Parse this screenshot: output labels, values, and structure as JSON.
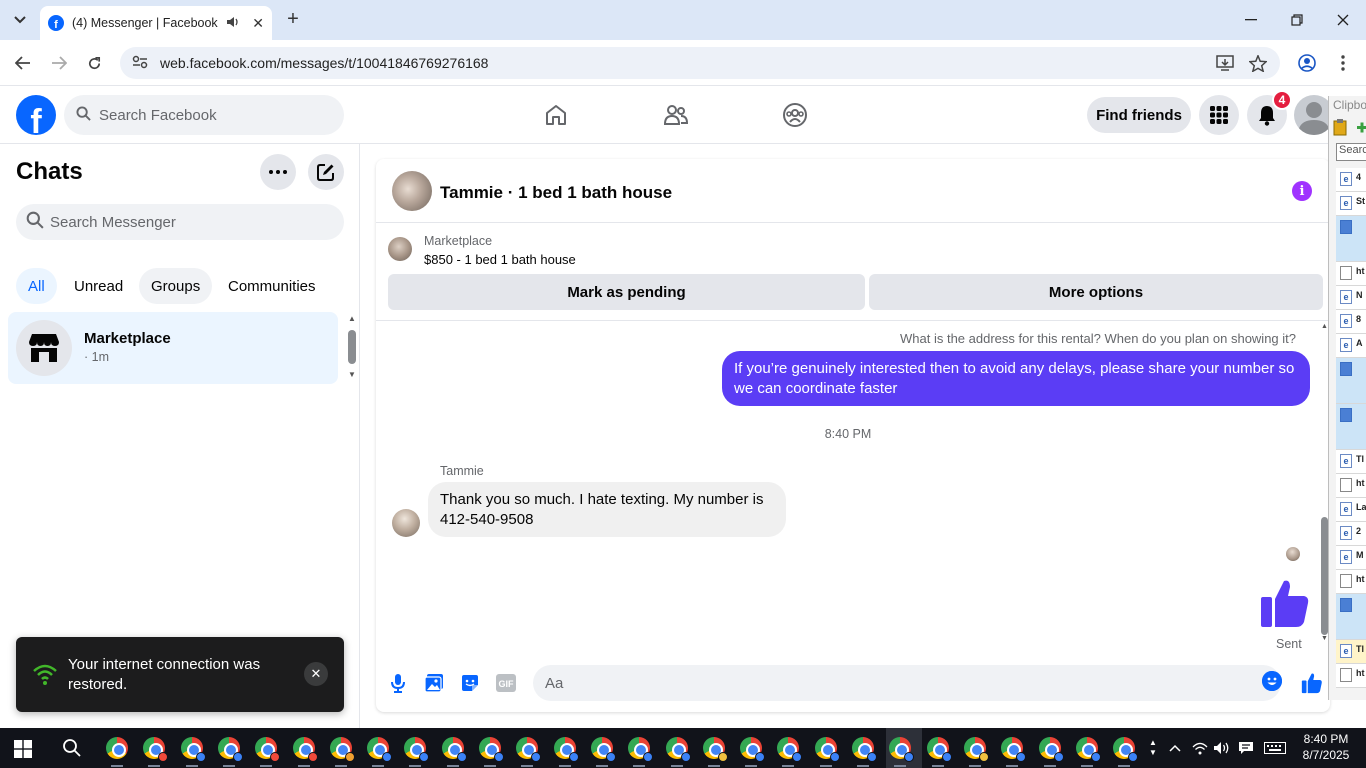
{
  "browser": {
    "tab_title": "(4) Messenger | Facebook",
    "url": "web.facebook.com/messages/t/10041846769276168",
    "tab_close": "✕",
    "new_tab": "+"
  },
  "header": {
    "search_placeholder": "Search Facebook",
    "find_friends": "Find friends",
    "notification_count": "4",
    "logo_letter": "f"
  },
  "sidebar": {
    "title": "Chats",
    "search_placeholder": "Search Messenger",
    "filters": [
      "All",
      "Unread",
      "Groups",
      "Communities"
    ],
    "chat": {
      "name": "Marketplace",
      "time": "· 1m"
    }
  },
  "toast": {
    "text": "Your internet connection was restored.",
    "close": "✕"
  },
  "conversation": {
    "title": "Tammie · 1 bed 1 bath house",
    "marketplace_label": "Marketplace",
    "listing": "$850 - 1 bed 1 bath house",
    "mark_pending": "Mark as pending",
    "more_options": "More options",
    "quoted_text": "What is the address for this rental?  When do you plan on showing it?",
    "outgoing_message": "If you’re genuinely interested then to avoid any delays, please share your number so we can coordinate faster",
    "time_separator": "8:40 PM",
    "sender_name": "Tammie",
    "incoming_message": "Thank you so much. I hate texting.   My number is 412-540-9508",
    "sent_label": "Sent",
    "composer_placeholder": "Aa",
    "gif_label": "GIF"
  },
  "clipboard": {
    "title": "Clipboard",
    "search": "Search",
    "rows": [
      {
        "icon": "e",
        "text": "4"
      },
      {
        "icon": "e",
        "text": "St"
      },
      {
        "icon": "img",
        "text": ""
      },
      {
        "icon": "doc",
        "text": "ht"
      },
      {
        "icon": "e",
        "text": "N"
      },
      {
        "icon": "e",
        "text": "8"
      },
      {
        "icon": "e",
        "text": "A"
      },
      {
        "icon": "img",
        "text": ""
      },
      {
        "icon": "img",
        "text": ""
      },
      {
        "icon": "e",
        "text": "Tl"
      },
      {
        "icon": "doc",
        "text": "ht"
      },
      {
        "icon": "e",
        "text": "La"
      },
      {
        "icon": "e",
        "text": "2"
      },
      {
        "icon": "e",
        "text": "M"
      },
      {
        "icon": "doc",
        "text": "ht"
      },
      {
        "icon": "img",
        "text": ""
      },
      {
        "icon": "e",
        "text": "Tl"
      },
      {
        "icon": "doc",
        "text": "ht"
      }
    ]
  },
  "taskbar": {
    "time": "8:40 PM",
    "date": "8/7/2025"
  },
  "colors": {
    "facebook_blue": "#0866ff",
    "outgoing_bubble": "#5b3df5",
    "info_purple": "#a033ff",
    "notification_red": "#e41e3f"
  }
}
